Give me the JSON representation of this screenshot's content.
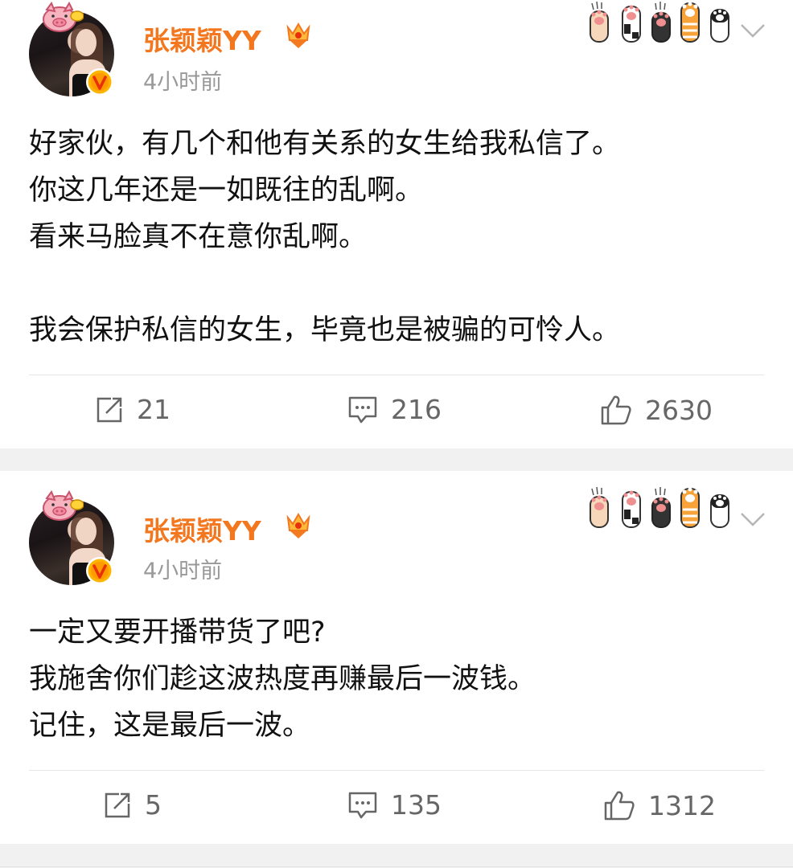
{
  "posts": [
    {
      "author": "张颖颖YY",
      "time": "4小时前",
      "lines": [
        "好家伙，有几个和他有关系的女生给我私信了。",
        "你这几年还是一如既往的乱啊。",
        "看来马脸真不在意你乱啊。",
        "",
        "我会保护私信的女生，毕竟也是被骗的可怜人。"
      ],
      "reposts": "21",
      "comments": "216",
      "likes": "2630"
    },
    {
      "author": "张颖颖YY",
      "time": "4小时前",
      "lines": [
        "一定又要开播带货了吧?",
        "我施舍你们趁这波热度再赚最后一波钱。",
        "记住，这是最后一波。"
      ],
      "reposts": "5",
      "comments": "135",
      "likes": "1312"
    }
  ],
  "icons": {
    "repost": "share-icon",
    "comment": "comment-icon",
    "like": "thumbs-up-icon",
    "more": "chevron-down-icon",
    "decoration": "cat-paws-icon"
  },
  "colors": {
    "name": "#f3771e",
    "verified": "#ffb400",
    "text": "#111111",
    "muted": "#999999"
  }
}
